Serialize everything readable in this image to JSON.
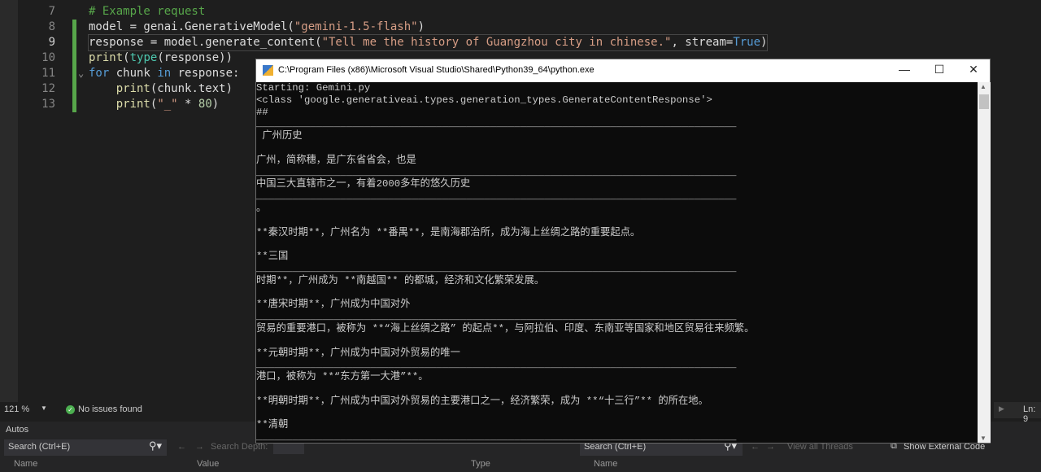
{
  "editor": {
    "lines": [
      {
        "num": "7",
        "tokens": [
          {
            "c": "t-c",
            "t": "# Example request"
          }
        ]
      },
      {
        "num": "8",
        "tokens": [
          {
            "c": "t-v",
            "t": "model = genai.GenerativeModel("
          },
          {
            "c": "t-s",
            "t": "\"gemini-1.5-flash\""
          },
          {
            "c": "t-p",
            "t": ")"
          }
        ]
      },
      {
        "num": "9",
        "tokens": [
          {
            "c": "t-v",
            "t": "response = model.generate_content("
          },
          {
            "c": "t-s",
            "t": "\"Tell me the history of Guangzhou city in chinese.\""
          },
          {
            "c": "t-p",
            "t": ", stream="
          },
          {
            "c": "t-k",
            "t": "True"
          },
          {
            "c": "t-p",
            "t": ")"
          }
        ]
      },
      {
        "num": "10",
        "tokens": [
          {
            "c": "t-f",
            "t": "print"
          },
          {
            "c": "t-p",
            "t": "("
          },
          {
            "c": "t-t",
            "t": "type"
          },
          {
            "c": "t-p",
            "t": "(response))"
          }
        ]
      },
      {
        "num": "11",
        "tokens": [
          {
            "c": "t-k",
            "t": "for"
          },
          {
            "c": "t-v",
            "t": " chunk "
          },
          {
            "c": "t-k",
            "t": "in"
          },
          {
            "c": "t-v",
            "t": " response:"
          }
        ]
      },
      {
        "num": "12",
        "tokens": [
          {
            "c": "t-v",
            "t": "    "
          },
          {
            "c": "t-f",
            "t": "print"
          },
          {
            "c": "t-p",
            "t": "(chunk.text)"
          }
        ]
      },
      {
        "num": "13",
        "tokens": [
          {
            "c": "t-v",
            "t": "    "
          },
          {
            "c": "t-f",
            "t": "print"
          },
          {
            "c": "t-p",
            "t": "("
          },
          {
            "c": "t-s",
            "t": "\"_\""
          },
          {
            "c": "t-p",
            "t": " * "
          },
          {
            "c": "t-n",
            "t": "80"
          },
          {
            "c": "t-p",
            "t": ")"
          }
        ]
      }
    ]
  },
  "status": {
    "zoom": "121 %",
    "issues": "No issues found",
    "line": "Ln: 9"
  },
  "autos": {
    "title": "Autos",
    "search_placeholder": "Search (Ctrl+E)",
    "search_depth": "Search Depth:",
    "columns": [
      "Name",
      "Value",
      "Type"
    ]
  },
  "callstack": {
    "search_placeholder": "Search (Ctrl+E)",
    "view_threads": "View all Threads",
    "show_external": "Show External Code",
    "columns": [
      "Name"
    ]
  },
  "console": {
    "title": "C:\\Program Files (x86)\\Microsoft Visual Studio\\Shared\\Python39_64\\python.exe",
    "output": "Starting: Gemini.py\n<class 'google.generativeai.types.generation_types.GenerateContentResponse'>\n##\n________________________________________________________________________________\n 广州历史\n\n广州，简称穗，是广东省省会，也是\n________________________________________________________________________________\n中国三大直辖市之一，有着2000多年的悠久历史\n________________________________________________________________________________\n。\n\n**秦汉时期**，广州名为 **番禺**，是南海郡治所，成为海上丝绸之路的重要起点。\n\n**三国\n________________________________________________________________________________\n时期**，广州成为 **南越国** 的都城，经济和文化繁荣发展。\n\n**唐宋时期**，广州成为中国对外\n________________________________________________________________________________\n贸易的重要港口，被称为 **“海上丝绸之路” 的起点**，与阿拉伯、印度、东南亚等国家和地区贸易往来频繁。\n\n**元朝时期**，广州成为中国对外贸易的唯一\n________________________________________________________________________________\n港口，被称为 **“东方第一大港”**。\n\n**明朝时期**，广州成为中国对外贸易的主要港口之一，经济繁荣，成为 **“十三行”** 的所在地。\n\n**清朝\n________________________________________________________________________________"
  }
}
